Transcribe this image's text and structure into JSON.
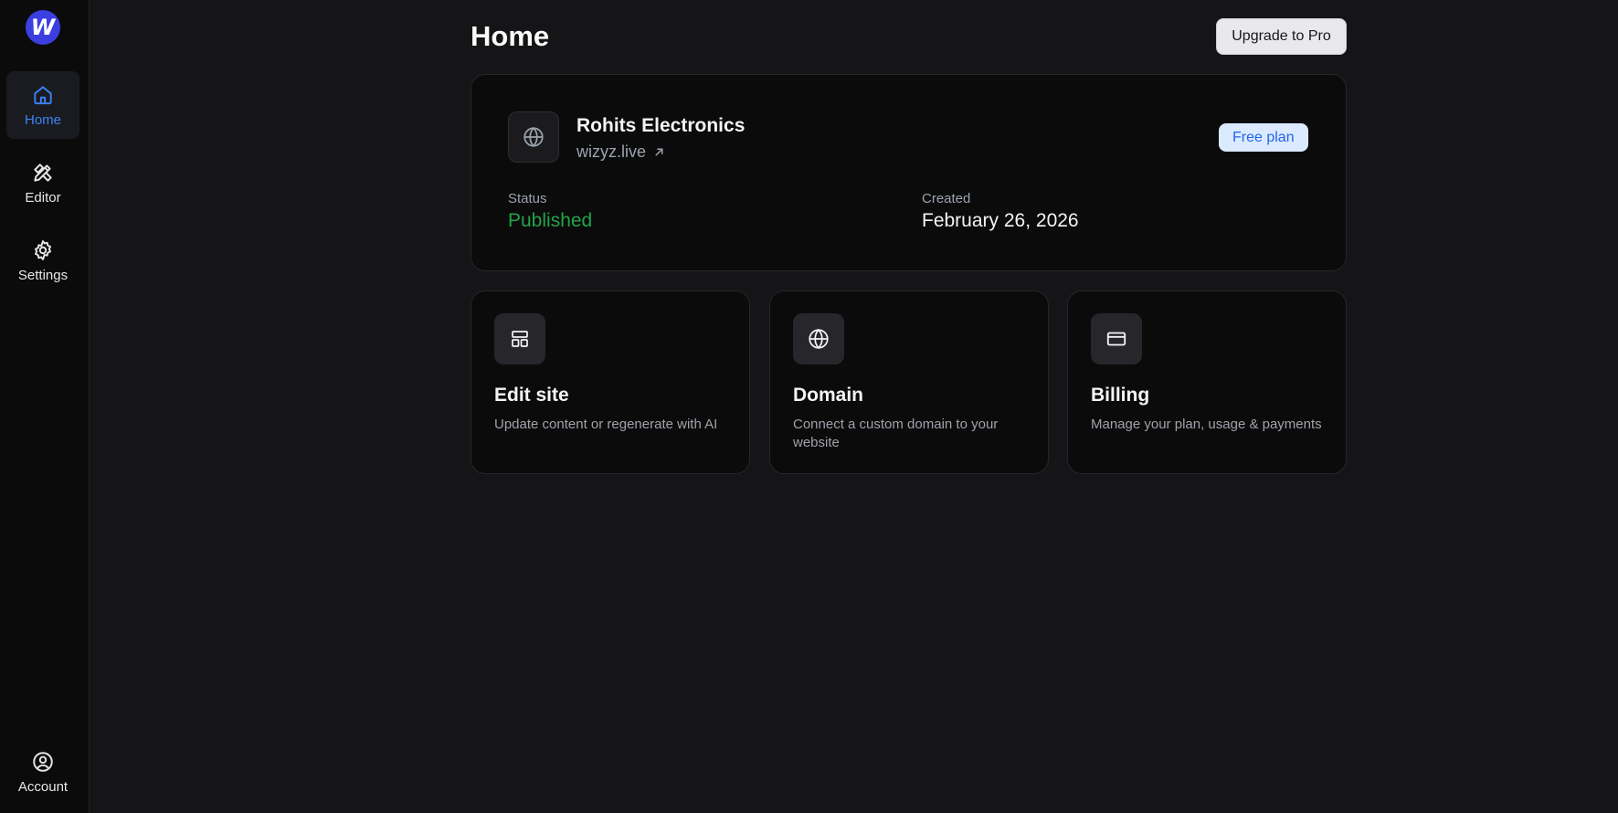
{
  "logo": {
    "letter": "W"
  },
  "sidebar": {
    "items": [
      {
        "label": "Home",
        "icon": "home-icon"
      },
      {
        "label": "Editor",
        "icon": "pencil-ruler-icon"
      },
      {
        "label": "Settings",
        "icon": "gear-icon"
      }
    ],
    "account": {
      "label": "Account",
      "icon": "user-circle-icon"
    }
  },
  "header": {
    "title": "Home",
    "upgrade_label": "Upgrade to Pro"
  },
  "site": {
    "name": "Rohits Electronics",
    "url": "wizyz.live",
    "plan": "Free plan",
    "status_label": "Status",
    "status_value": "Published",
    "created_label": "Created",
    "created_value": "February 26, 2026"
  },
  "actions": [
    {
      "title": "Edit site",
      "description": "Update content or regenerate with AI",
      "icon": "layout-icon"
    },
    {
      "title": "Domain",
      "description": "Connect a custom domain to your website",
      "icon": "globe-icon"
    },
    {
      "title": "Billing",
      "description": "Manage your plan, usage & payments",
      "icon": "credit-card-icon"
    }
  ],
  "colors": {
    "accent": "#3b82f6",
    "published": "#22a447",
    "background": "#151517",
    "card": "#0b0b0c"
  }
}
